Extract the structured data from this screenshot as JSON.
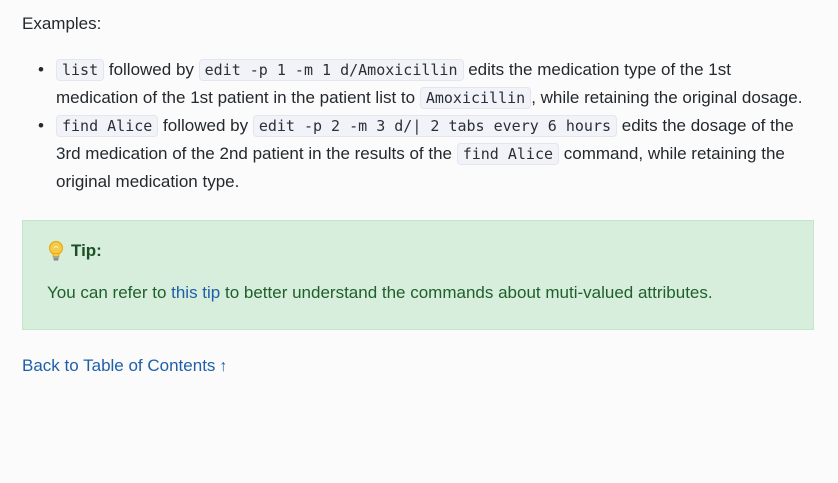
{
  "examples_label": "Examples:",
  "examples": [
    {
      "code1": "list",
      "text1": " followed by ",
      "code2": "edit -p 1 -m 1 d/Amoxicillin",
      "text2": " edits the medication type of the 1st medication of the 1st patient in the patient list to ",
      "code3": "Amoxicillin",
      "text3": ", while retaining the original dosage."
    },
    {
      "code1": "find Alice",
      "text1": " followed by ",
      "code2": "edit -p 2 -m 3 d/| 2 tabs every 6 hours",
      "text2": " edits the dosage of the 3rd medication of the 2nd patient in the results of the ",
      "code3": "find Alice",
      "text3": " command, while retaining the original medication type."
    }
  ],
  "tip": {
    "title": "Tip:",
    "text_before": "You can refer to ",
    "link_text": "this tip",
    "text_after": " to better understand the commands about muti-valued attributes."
  },
  "back_link": {
    "label": "Back to Table of Contents",
    "arrow": "↑"
  },
  "colors": {
    "tip_background": "#d6eedb",
    "tip_text": "#1f5f2b",
    "link": "#1f5fa8",
    "code_background": "#f1f3f8"
  },
  "icons": {
    "tip_icon": "lightbulb-icon",
    "back_icon": "arrow-up-icon"
  }
}
